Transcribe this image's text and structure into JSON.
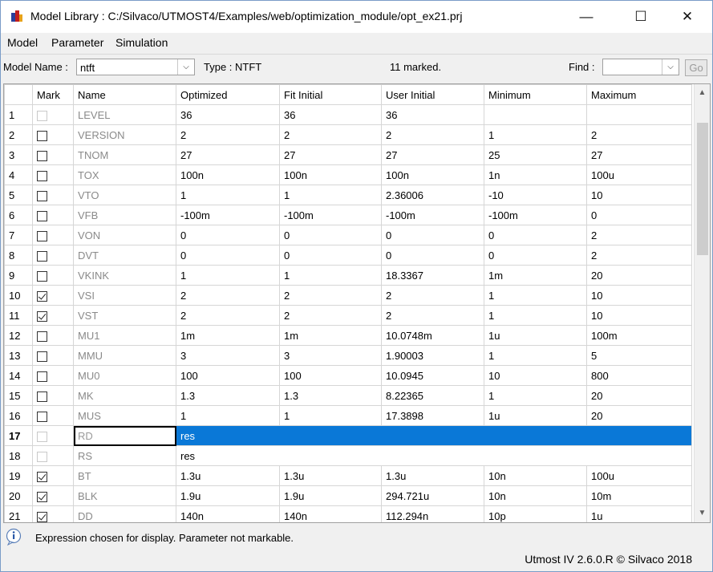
{
  "window": {
    "title": "Model Library : C:/Silvaco/UTMOST4/Examples/web/optimization_module/opt_ex21.prj",
    "minimize_glyph": "—",
    "maximize_glyph": "☐",
    "close_glyph": "✕"
  },
  "menu": {
    "items": [
      "Model",
      "Parameter",
      "Simulation"
    ]
  },
  "toolbar": {
    "model_name_label": "Model Name :",
    "model_name_value": "ntft",
    "type_label": "Type : NTFT",
    "marked_count": "11 marked.",
    "find_label": "Find :",
    "find_value": "",
    "go_label": "Go"
  },
  "grid": {
    "columns": [
      "",
      "Mark",
      "Name",
      "Optimized",
      "Fit Initial",
      "User Initial",
      "Minimum",
      "Maximum"
    ],
    "rows": [
      {
        "idx": "1",
        "mark": "disabled",
        "name": "LEVEL",
        "optimized": "36",
        "fit": "36",
        "user": "36",
        "min": "",
        "max": ""
      },
      {
        "idx": "2",
        "mark": "unchecked",
        "name": "VERSION",
        "optimized": "2",
        "fit": "2",
        "user": "2",
        "min": "1",
        "max": "2"
      },
      {
        "idx": "3",
        "mark": "unchecked",
        "name": "TNOM",
        "optimized": "27",
        "fit": "27",
        "user": "27",
        "min": "25",
        "max": "27"
      },
      {
        "idx": "4",
        "mark": "unchecked",
        "name": "TOX",
        "optimized": "100n",
        "fit": "100n",
        "user": "100n",
        "min": "1n",
        "max": "100u"
      },
      {
        "idx": "5",
        "mark": "unchecked",
        "name": "VTO",
        "optimized": "1",
        "fit": "1",
        "user": "2.36006",
        "min": "-10",
        "max": "10"
      },
      {
        "idx": "6",
        "mark": "unchecked",
        "name": "VFB",
        "optimized": "-100m",
        "fit": "-100m",
        "user": "-100m",
        "min": "-100m",
        "max": "0"
      },
      {
        "idx": "7",
        "mark": "unchecked",
        "name": "VON",
        "optimized": "0",
        "fit": "0",
        "user": "0",
        "min": "0",
        "max": "2"
      },
      {
        "idx": "8",
        "mark": "unchecked",
        "name": "DVT",
        "optimized": "0",
        "fit": "0",
        "user": "0",
        "min": "0",
        "max": "2"
      },
      {
        "idx": "9",
        "mark": "unchecked",
        "name": "VKINK",
        "optimized": "1",
        "fit": "1",
        "user": "18.3367",
        "min": "1m",
        "max": "20"
      },
      {
        "idx": "10",
        "mark": "checked",
        "name": "VSI",
        "optimized": "2",
        "fit": "2",
        "user": "2",
        "min": "1",
        "max": "10"
      },
      {
        "idx": "11",
        "mark": "checked",
        "name": "VST",
        "optimized": "2",
        "fit": "2",
        "user": "2",
        "min": "1",
        "max": "10"
      },
      {
        "idx": "12",
        "mark": "unchecked",
        "name": "MU1",
        "optimized": "1m",
        "fit": "1m",
        "user": "10.0748m",
        "min": "1u",
        "max": "100m"
      },
      {
        "idx": "13",
        "mark": "unchecked",
        "name": "MMU",
        "optimized": "3",
        "fit": "3",
        "user": "1.90003",
        "min": "1",
        "max": "5"
      },
      {
        "idx": "14",
        "mark": "unchecked",
        "name": "MU0",
        "optimized": "100",
        "fit": "100",
        "user": "10.0945",
        "min": "10",
        "max": "800"
      },
      {
        "idx": "15",
        "mark": "unchecked",
        "name": "MK",
        "optimized": "1.3",
        "fit": "1.3",
        "user": "8.22365",
        "min": "1",
        "max": "20"
      },
      {
        "idx": "16",
        "mark": "unchecked",
        "name": "MUS",
        "optimized": "1",
        "fit": "1",
        "user": "17.3898",
        "min": "1u",
        "max": "20"
      },
      {
        "idx": "17",
        "mark": "disabled",
        "name": "RD",
        "expression": "res",
        "selected": true
      },
      {
        "idx": "18",
        "mark": "disabled",
        "name": "RS",
        "expression": "res"
      },
      {
        "idx": "19",
        "mark": "checked",
        "name": "BT",
        "optimized": "1.3u",
        "fit": "1.3u",
        "user": "1.3u",
        "min": "10n",
        "max": "100u"
      },
      {
        "idx": "20",
        "mark": "checked",
        "name": "BLK",
        "optimized": "1.9u",
        "fit": "1.9u",
        "user": "294.721u",
        "min": "10n",
        "max": "10m"
      },
      {
        "idx": "21",
        "mark": "checked",
        "name": "DD",
        "optimized": "140n",
        "fit": "140n",
        "user": "112.294n",
        "min": "10p",
        "max": "1u"
      }
    ]
  },
  "status": {
    "message": "Expression chosen for display. Parameter not markable.",
    "version": "Utmost IV 2.6.0.R © Silvaco 2018"
  },
  "colors": {
    "selection": "#0a78d7",
    "grid_line": "#d6d6d6",
    "name_text": "#8a8a8a"
  }
}
